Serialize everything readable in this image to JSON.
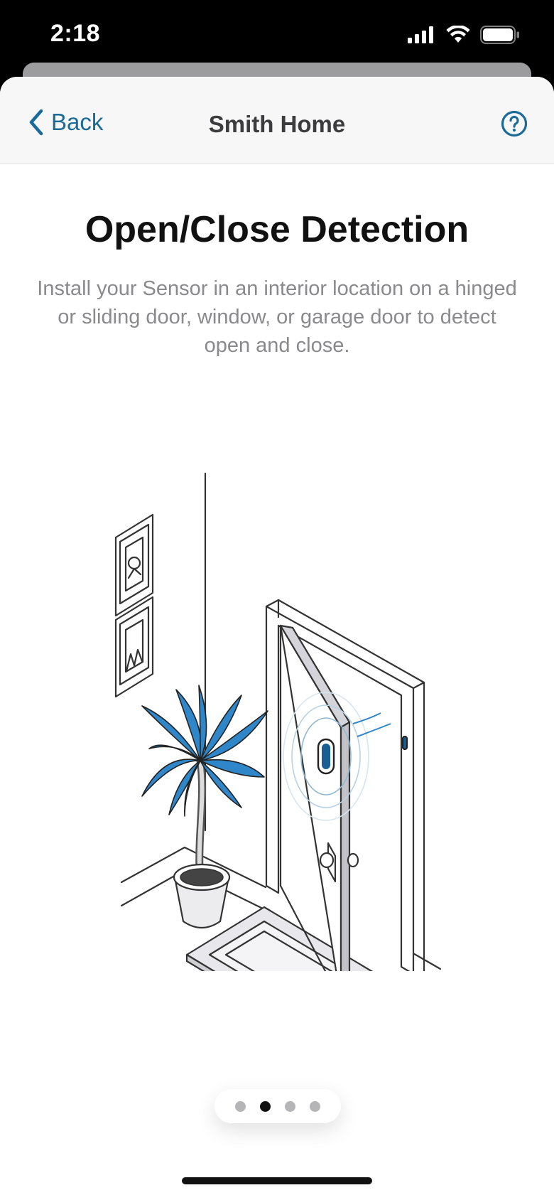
{
  "status_bar": {
    "time": "2:18",
    "icons": [
      "cellular-signal-icon",
      "wifi-icon",
      "battery-icon"
    ]
  },
  "nav": {
    "back_label": "Back",
    "title": "Smith Home",
    "help_icon": "question-circle-icon"
  },
  "content": {
    "title": "Open/Close Detection",
    "description": "Install your Sensor in an interior location on a hinged or sliding door, window, or garage door to detect open and close.",
    "illustration": "door-sensor-illustration"
  },
  "pager": {
    "page_count": 4,
    "active_index": 1
  },
  "colors": {
    "accent": "#1a6a9a",
    "plant": "#2f86c8",
    "title": "#111111",
    "description": "#8a8a8d"
  }
}
